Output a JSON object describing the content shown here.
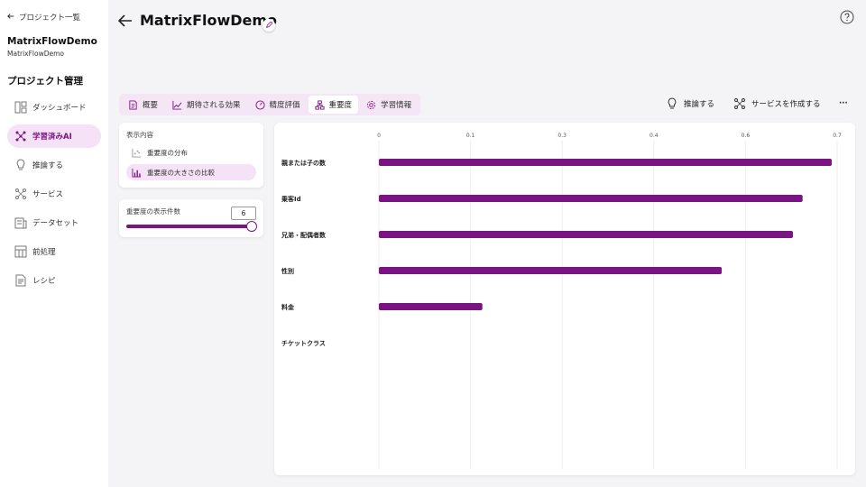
{
  "sidebar": {
    "back_label": "プロジェクト一覧",
    "project_name": "MatrixFlowDemo",
    "project_sub": "MatrixFlowDemo",
    "section_title": "プロジェクト管理",
    "items": [
      {
        "label": "ダッシュボード",
        "icon": "dashboard-icon",
        "active": false
      },
      {
        "label": "学習済みAI",
        "icon": "trained-ai-icon",
        "active": true
      },
      {
        "label": "推論する",
        "icon": "lightbulb-icon",
        "active": false
      },
      {
        "label": "サービス",
        "icon": "service-icon",
        "active": false
      },
      {
        "label": "データセット",
        "icon": "dataset-icon",
        "active": false
      },
      {
        "label": "前処理",
        "icon": "preprocess-icon",
        "active": false
      },
      {
        "label": "レシピ",
        "icon": "recipe-icon",
        "active": false
      }
    ]
  },
  "header": {
    "title": "MatrixFlowDemo"
  },
  "tabs": [
    {
      "label": "概要",
      "icon": "document-icon",
      "active": false
    },
    {
      "label": "期待される効果",
      "icon": "trend-icon",
      "active": false
    },
    {
      "label": "精度評価",
      "icon": "gauge-icon",
      "active": false
    },
    {
      "label": "重要度",
      "icon": "importance-icon",
      "active": true
    },
    {
      "label": "学習情報",
      "icon": "gear-icon",
      "active": false
    }
  ],
  "toolbar": {
    "infer_label": "推論する",
    "create_service_label": "サービスを作成する",
    "more_label": "···"
  },
  "display_panel": {
    "label": "表示内容",
    "options": [
      {
        "label": "重要度の分布",
        "active": false
      },
      {
        "label": "重要度の大きさの比較",
        "active": true
      }
    ]
  },
  "count_panel": {
    "label": "重要度の表示件数",
    "value": "6",
    "slider_fraction": 1.0
  },
  "colors": {
    "accent": "#7a1483",
    "accent_light": "#f6e2f6"
  },
  "chart_data": {
    "type": "bar",
    "orientation": "horizontal",
    "categories": [
      "親または子の数",
      "乗客Id",
      "兄弟・配偶者数",
      "性別",
      "料金",
      "チケットクラス"
    ],
    "values": [
      0.7,
      0.655,
      0.64,
      0.53,
      0.16,
      0.0
    ],
    "xlim": [
      0,
      0.7
    ],
    "xticks": [
      "0",
      "0.1",
      "0.3",
      "0.4",
      "0.6",
      "0.7"
    ],
    "xtick_values": [
      0,
      0.1,
      0.2,
      0.3,
      0.4,
      0.5
    ],
    "grid": true
  }
}
